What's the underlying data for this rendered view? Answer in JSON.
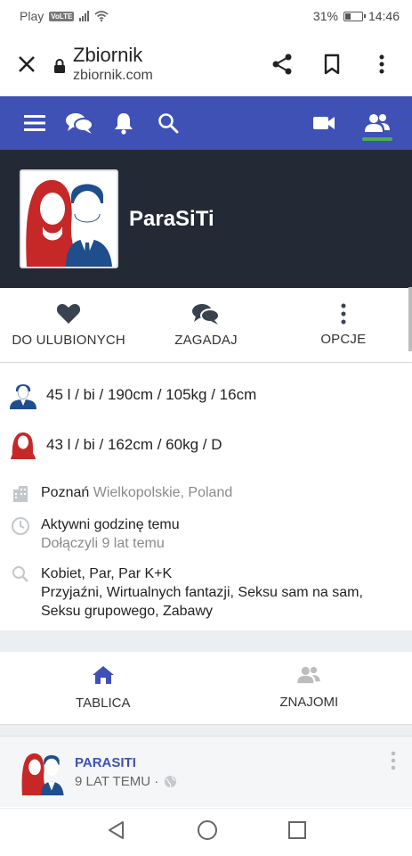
{
  "status_bar": {
    "carrier": "Play",
    "volte": "VoLTE",
    "battery": "31%",
    "battery_level": 0.31,
    "time": "14:46"
  },
  "browser": {
    "title": "Zbiornik",
    "url": "zbiornik.com"
  },
  "profile": {
    "name": "ParaSiTi"
  },
  "actions": [
    {
      "label": "DO ULUBIONYCH",
      "icon": "heart-icon"
    },
    {
      "label": "ZAGADAJ",
      "icon": "chat-bubbles-icon"
    },
    {
      "label": "OPCJE",
      "icon": "more-vertical-icon"
    }
  ],
  "details": {
    "male": "45 l / bi / 190cm / 105kg / 16cm",
    "female": "43 l / bi / 162cm / 60kg / D",
    "city": "Poznań",
    "region": "Wielkopolskie, Poland",
    "activity": "Aktywni godzinę temu",
    "joined": "Dołączyli 9 lat temu",
    "seeking_line1": "Kobiet, Par, Par K+K",
    "seeking_line2": "Przyjaźni, Wirtualnych fantazji, Seksu sam na sam,",
    "seeking_line3": "Seksu grupowego, Zabawy"
  },
  "tabs": [
    {
      "label": "TABLICA",
      "icon": "home-icon",
      "color": "#3f51b5"
    },
    {
      "label": "ZNAJOMI",
      "icon": "friends-icon",
      "color": "#9e9e9e"
    }
  ],
  "post": {
    "author": "PARASITI",
    "time": "9 LAT TEMU ·"
  },
  "colors": {
    "nav_bg": "#3f51b5",
    "header_bg": "#232a35",
    "active_tab": "#4caf50",
    "female_red": "#c62828",
    "male_blue": "#1e4e8c"
  }
}
